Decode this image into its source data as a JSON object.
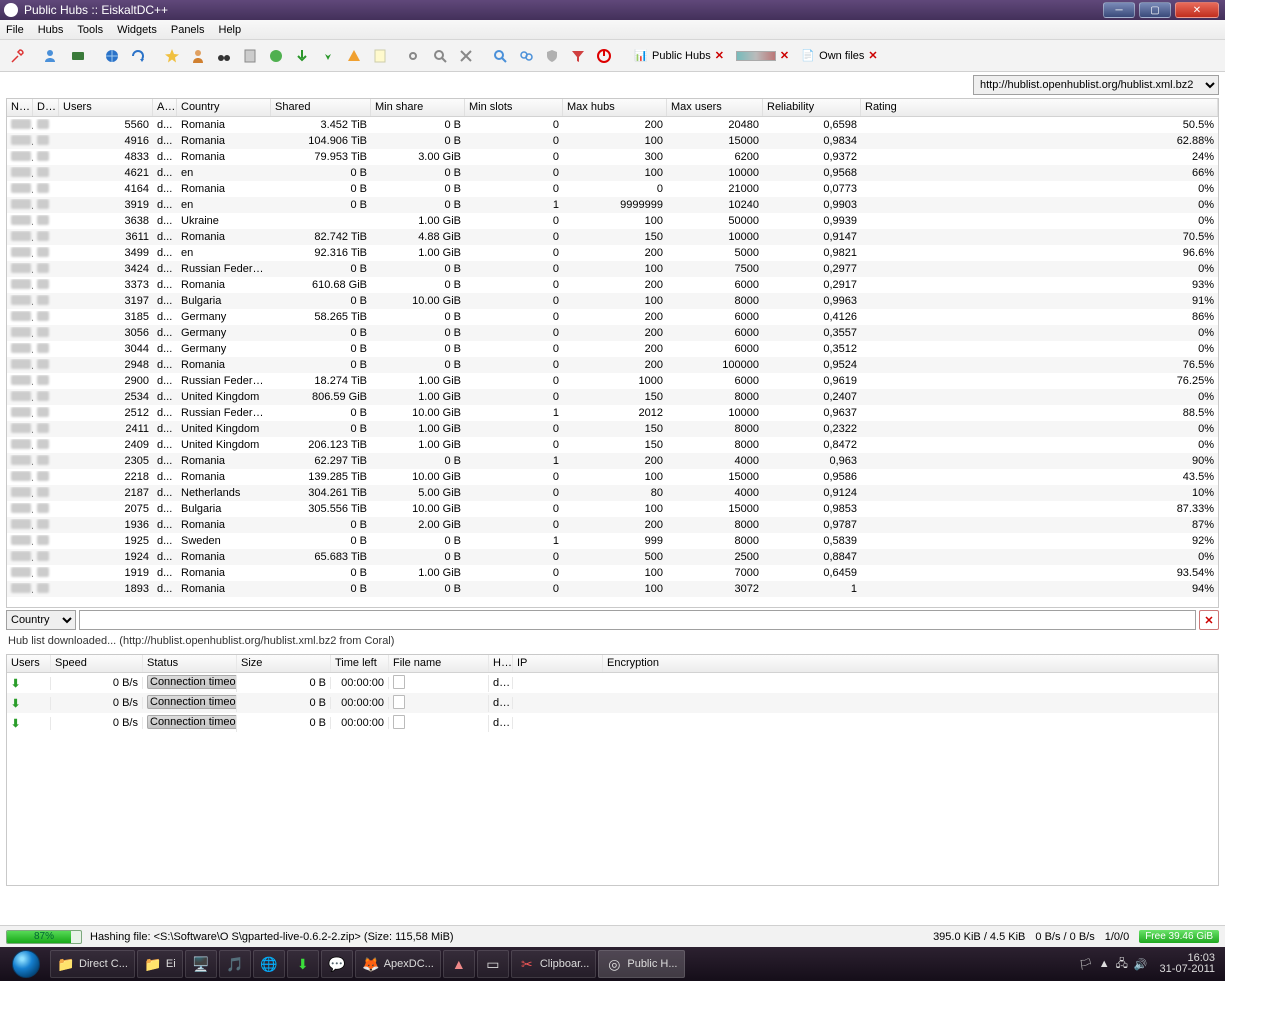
{
  "window": {
    "title": "Public Hubs :: EiskaltDC++"
  },
  "menu": {
    "file": "File",
    "hubs": "Hubs",
    "tools": "Tools",
    "widgets": "Widgets",
    "panels": "Panels",
    "help": "Help"
  },
  "tabs": {
    "public_hubs": "Public Hubs",
    "own_files": "Own files"
  },
  "hublist_url": "http://hublist.openhublist.org/hublist.xml.bz2",
  "hubcols": {
    "nar": "Nar",
    "des": "Des",
    "users": "Users",
    "add": "Adc",
    "country": "Country",
    "shared": "Shared",
    "minshare": "Min share",
    "minslots": "Min slots",
    "maxhubs": "Max hubs",
    "maxusers": "Max users",
    "reliability": "Reliability",
    "rating": "Rating"
  },
  "hubs": [
    {
      "users": "5560",
      "add": "d...",
      "country": "Romania",
      "shared": "3.452 TiB",
      "minshare": "0 B",
      "minslots": "0",
      "maxhubs": "200",
      "maxusers": "20480",
      "reliability": "0,6598",
      "rating": "50.5%"
    },
    {
      "users": "4916",
      "add": "d...",
      "country": "Romania",
      "shared": "104.906 TiB",
      "minshare": "0 B",
      "minslots": "0",
      "maxhubs": "100",
      "maxusers": "15000",
      "reliability": "0,9834",
      "rating": "62.88%"
    },
    {
      "users": "4833",
      "add": "d...",
      "country": "Romania",
      "shared": "79.953 TiB",
      "minshare": "3.00 GiB",
      "minslots": "0",
      "maxhubs": "300",
      "maxusers": "6200",
      "reliability": "0,9372",
      "rating": "24%"
    },
    {
      "users": "4621",
      "add": "d...",
      "country": "en",
      "shared": "0 B",
      "minshare": "0 B",
      "minslots": "0",
      "maxhubs": "100",
      "maxusers": "10000",
      "reliability": "0,9568",
      "rating": "66%"
    },
    {
      "users": "4164",
      "add": "d...",
      "country": "Romania",
      "shared": "0 B",
      "minshare": "0 B",
      "minslots": "0",
      "maxhubs": "0",
      "maxusers": "21000",
      "reliability": "0,0773",
      "rating": "0%"
    },
    {
      "users": "3919",
      "add": "d...",
      "country": "en",
      "shared": "0 B",
      "minshare": "0 B",
      "minslots": "1",
      "maxhubs": "9999999",
      "maxusers": "10240",
      "reliability": "0,9903",
      "rating": "0%"
    },
    {
      "users": "3638",
      "add": "d...",
      "country": "Ukraine",
      "shared": "",
      "minshare": "1.00 GiB",
      "minslots": "0",
      "maxhubs": "100",
      "maxusers": "50000",
      "reliability": "0,9939",
      "rating": "0%"
    },
    {
      "users": "3611",
      "add": "d...",
      "country": "Romania",
      "shared": "82.742 TiB",
      "minshare": "4.88 GiB",
      "minslots": "0",
      "maxhubs": "150",
      "maxusers": "10000",
      "reliability": "0,9147",
      "rating": "70.5%"
    },
    {
      "users": "3499",
      "add": "d...",
      "country": "en",
      "shared": "92.316 TiB",
      "minshare": "1.00 GiB",
      "minslots": "0",
      "maxhubs": "200",
      "maxusers": "5000",
      "reliability": "0,9821",
      "rating": "96.6%"
    },
    {
      "users": "3424",
      "add": "d...",
      "country": "Russian Federat...",
      "shared": "0 B",
      "minshare": "0 B",
      "minslots": "0",
      "maxhubs": "100",
      "maxusers": "7500",
      "reliability": "0,2977",
      "rating": "0%"
    },
    {
      "users": "3373",
      "add": "d...",
      "country": "Romania",
      "shared": "610.68 GiB",
      "minshare": "0 B",
      "minslots": "0",
      "maxhubs": "200",
      "maxusers": "6000",
      "reliability": "0,2917",
      "rating": "93%"
    },
    {
      "users": "3197",
      "add": "d...",
      "country": "Bulgaria",
      "shared": "0 B",
      "minshare": "10.00 GiB",
      "minslots": "0",
      "maxhubs": "100",
      "maxusers": "8000",
      "reliability": "0,9963",
      "rating": "91%"
    },
    {
      "users": "3185",
      "add": "d...",
      "country": "Germany",
      "shared": "58.265 TiB",
      "minshare": "0 B",
      "minslots": "0",
      "maxhubs": "200",
      "maxusers": "6000",
      "reliability": "0,4126",
      "rating": "86%"
    },
    {
      "users": "3056",
      "add": "d...",
      "country": "Germany",
      "shared": "0 B",
      "minshare": "0 B",
      "minslots": "0",
      "maxhubs": "200",
      "maxusers": "6000",
      "reliability": "0,3557",
      "rating": "0%"
    },
    {
      "users": "3044",
      "add": "d...",
      "country": "Germany",
      "shared": "0 B",
      "minshare": "0 B",
      "minslots": "0",
      "maxhubs": "200",
      "maxusers": "6000",
      "reliability": "0,3512",
      "rating": "0%"
    },
    {
      "users": "2948",
      "add": "d...",
      "country": "Romania",
      "shared": "0 B",
      "minshare": "0 B",
      "minslots": "0",
      "maxhubs": "200",
      "maxusers": "100000",
      "reliability": "0,9524",
      "rating": "76.5%"
    },
    {
      "users": "2900",
      "add": "d...",
      "country": "Russian Federat...",
      "shared": "18.274 TiB",
      "minshare": "1.00 GiB",
      "minslots": "0",
      "maxhubs": "1000",
      "maxusers": "6000",
      "reliability": "0,9619",
      "rating": "76.25%"
    },
    {
      "users": "2534",
      "add": "d...",
      "country": "United Kingdom",
      "shared": "806.59 GiB",
      "minshare": "1.00 GiB",
      "minslots": "0",
      "maxhubs": "150",
      "maxusers": "8000",
      "reliability": "0,2407",
      "rating": "0%"
    },
    {
      "users": "2512",
      "add": "d...",
      "country": "Russian Federat...",
      "shared": "0 B",
      "minshare": "10.00 GiB",
      "minslots": "1",
      "maxhubs": "2012",
      "maxusers": "10000",
      "reliability": "0,9637",
      "rating": "88.5%"
    },
    {
      "users": "2411",
      "add": "d...",
      "country": "United Kingdom",
      "shared": "0 B",
      "minshare": "1.00 GiB",
      "minslots": "0",
      "maxhubs": "150",
      "maxusers": "8000",
      "reliability": "0,2322",
      "rating": "0%"
    },
    {
      "users": "2409",
      "add": "d...",
      "country": "United Kingdom",
      "shared": "206.123 TiB",
      "minshare": "1.00 GiB",
      "minslots": "0",
      "maxhubs": "150",
      "maxusers": "8000",
      "reliability": "0,8472",
      "rating": "0%"
    },
    {
      "users": "2305",
      "add": "d...",
      "country": "Romania",
      "shared": "62.297 TiB",
      "minshare": "0 B",
      "minslots": "1",
      "maxhubs": "200",
      "maxusers": "4000",
      "reliability": "0,963",
      "rating": "90%"
    },
    {
      "users": "2218",
      "add": "d...",
      "country": "Romania",
      "shared": "139.285 TiB",
      "minshare": "10.00 GiB",
      "minslots": "0",
      "maxhubs": "100",
      "maxusers": "15000",
      "reliability": "0,9586",
      "rating": "43.5%"
    },
    {
      "users": "2187",
      "add": "d...",
      "country": "Netherlands",
      "shared": "304.261 TiB",
      "minshare": "5.00 GiB",
      "minslots": "0",
      "maxhubs": "80",
      "maxusers": "4000",
      "reliability": "0,9124",
      "rating": "10%"
    },
    {
      "users": "2075",
      "add": "d...",
      "country": "Bulgaria",
      "shared": "305.556 TiB",
      "minshare": "10.00 GiB",
      "minslots": "0",
      "maxhubs": "100",
      "maxusers": "15000",
      "reliability": "0,9853",
      "rating": "87.33%"
    },
    {
      "users": "1936",
      "add": "d...",
      "country": "Romania",
      "shared": "0 B",
      "minshare": "2.00 GiB",
      "minslots": "0",
      "maxhubs": "200",
      "maxusers": "8000",
      "reliability": "0,9787",
      "rating": "87%"
    },
    {
      "users": "1925",
      "add": "d...",
      "country": "Sweden",
      "shared": "0 B",
      "minshare": "0 B",
      "minslots": "1",
      "maxhubs": "999",
      "maxusers": "8000",
      "reliability": "0,5839",
      "rating": "92%"
    },
    {
      "users": "1924",
      "add": "d...",
      "country": "Romania",
      "shared": "65.683 TiB",
      "minshare": "0 B",
      "minslots": "0",
      "maxhubs": "500",
      "maxusers": "2500",
      "reliability": "0,8847",
      "rating": "0%"
    },
    {
      "users": "1919",
      "add": "d...",
      "country": "Romania",
      "shared": "0 B",
      "minshare": "1.00 GiB",
      "minslots": "0",
      "maxhubs": "100",
      "maxusers": "7000",
      "reliability": "0,6459",
      "rating": "93.54%"
    },
    {
      "users": "1893",
      "add": "d...",
      "country": "Romania",
      "shared": "0 B",
      "minshare": "0 B",
      "minslots": "0",
      "maxhubs": "100",
      "maxusers": "3072",
      "reliability": "1",
      "rating": "94%"
    }
  ],
  "filter": {
    "field": "Country",
    "value": ""
  },
  "statusmsg": "Hub list downloaded... (http://hublist.openhublist.org/hublist.xml.bz2 from Coral)",
  "xfercols": {
    "users": "Users",
    "speed": "Speed",
    "status": "Status",
    "size": "Size",
    "timeleft": "Time left",
    "filename": "File name",
    "host": "Hos",
    "ip": "IP",
    "encryption": "Encryption"
  },
  "xfers": [
    {
      "speed": "0 B/s",
      "status": "Connection timeout",
      "size": "0 B",
      "time": "00:00:00",
      "host": "d..."
    },
    {
      "speed": "0 B/s",
      "status": "Connection timeout",
      "size": "0 B",
      "time": "00:00:00",
      "host": "d..."
    },
    {
      "speed": "0 B/s",
      "status": "Connection timeout",
      "size": "0 B",
      "time": "00:00:00",
      "host": "d..."
    }
  ],
  "bottom": {
    "hash_pct": "87%",
    "hash_msg": "Hashing file: <S:\\Software\\O S\\gparted-live-0.6.2-2.zip> (Size: 115,58 MiB)",
    "traffic": "395.0 KiB / 4.5 KiB",
    "speed": "0 B/s / 0 B/s",
    "slots": "1/0/0",
    "free": "Free 39.46 GiB"
  },
  "taskbar": {
    "items": [
      {
        "label": "Direct C...",
        "icon": "📁"
      },
      {
        "label": "Ei",
        "icon": "📁"
      }
    ],
    "apex": "ApexDC...",
    "clipbo": "Clipboar...",
    "publich": "Public H...",
    "clock_time": "16:03",
    "clock_date": "31-07-2011"
  }
}
